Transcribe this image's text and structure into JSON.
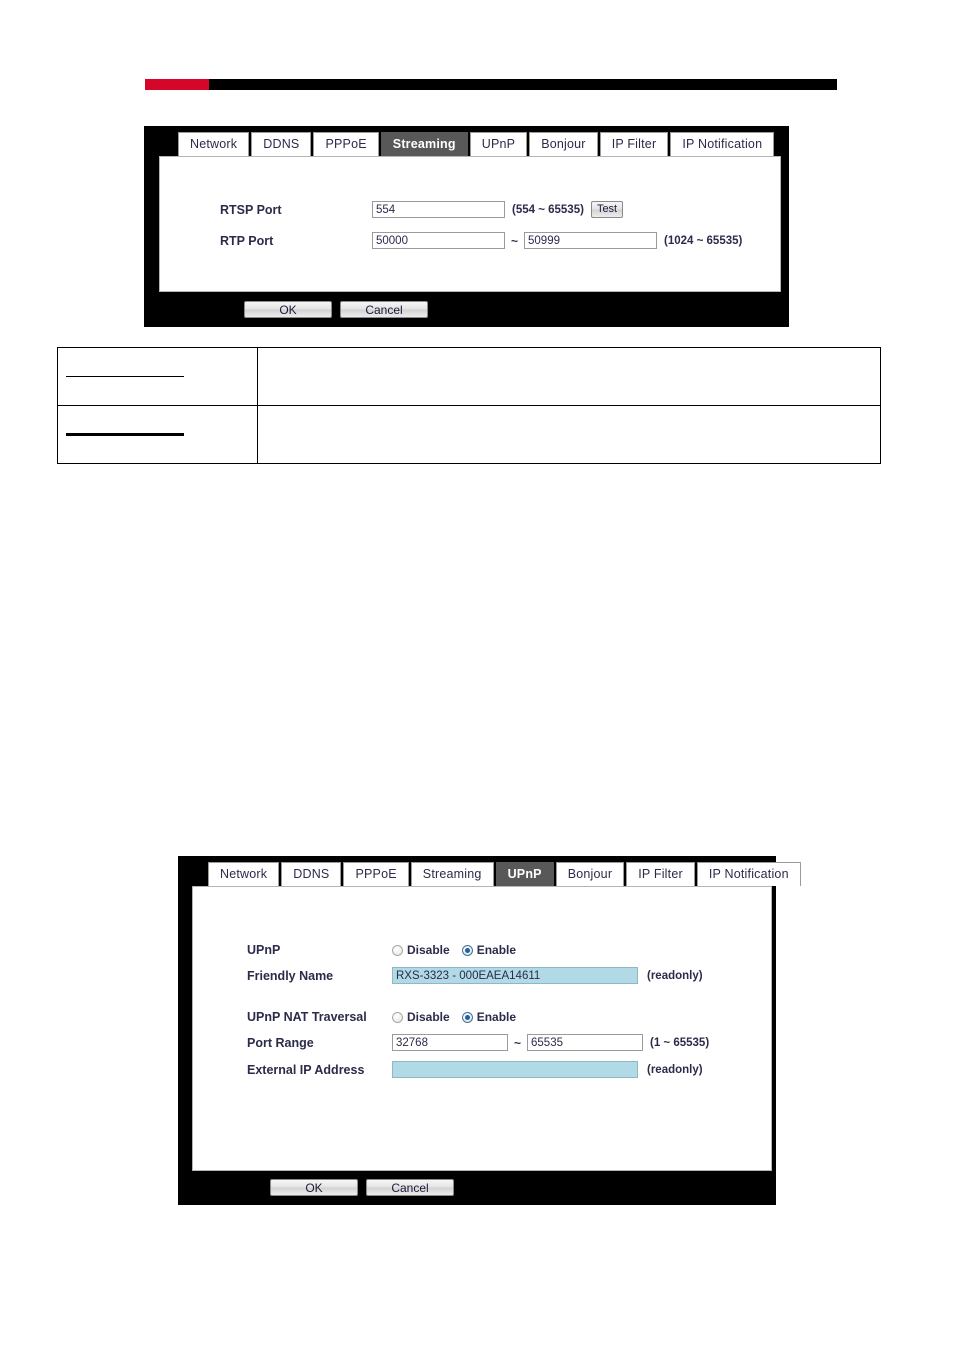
{
  "decor": {
    "header_rule_red": "#d4072a",
    "header_rule_black": "#000000"
  },
  "tabs": [
    "Network",
    "DDNS",
    "PPPoE",
    "Streaming",
    "UPnP",
    "Bonjour",
    "IP Filter",
    "IP Notification"
  ],
  "buttons": {
    "ok": "OK",
    "cancel": "Cancel",
    "test": "Test"
  },
  "streaming_panel": {
    "active_tab": "Streaming",
    "rows": [
      {
        "label": "RTSP Port",
        "value": "554",
        "hint": "(554 ~ 65535)",
        "has_test_button": true
      },
      {
        "label": "RTP Port",
        "value_start": "50000",
        "separator": "~",
        "value_end": "50999",
        "hint": "(1024 ~ 65535)"
      }
    ]
  },
  "upnp_panel": {
    "active_tab": "UPnP",
    "upnp": {
      "label": "UPnP",
      "options": [
        "Disable",
        "Enable"
      ],
      "selected": "Enable"
    },
    "friendly_name": {
      "label": "Friendly Name",
      "value": "RXS-3323 - 000EAEA14611",
      "hint": "(readonly)"
    },
    "nat_traversal": {
      "label": "UPnP NAT Traversal",
      "options": [
        "Disable",
        "Enable"
      ],
      "selected": "Enable"
    },
    "port_range": {
      "label": "Port Range",
      "value_start": "32768",
      "separator": "~",
      "value_end": "65535",
      "hint": "(1 ~ 65535)"
    },
    "external_ip": {
      "label": "External IP Address",
      "value": "",
      "hint": "(readonly)"
    }
  },
  "notes_table": {
    "rows": [
      {
        "term": "",
        "description": ""
      },
      {
        "term": "",
        "description": ""
      }
    ]
  }
}
